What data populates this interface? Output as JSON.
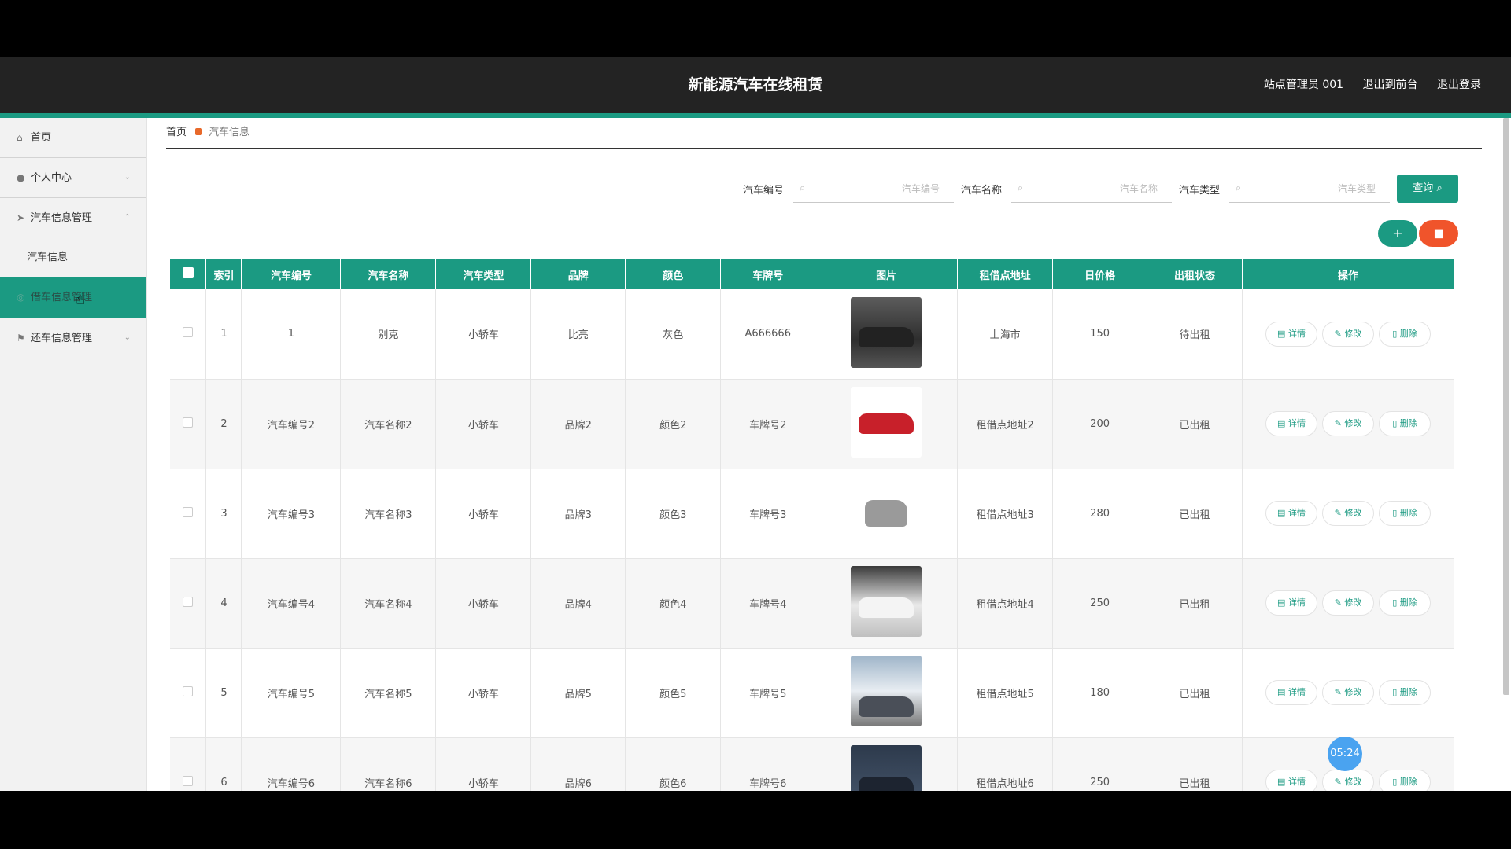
{
  "header": {
    "title": "新能源汽车在线租赁",
    "user": "站点管理员 001",
    "to_front": "退出到前台",
    "logout": "退出登录"
  },
  "sidebar": {
    "items": [
      {
        "label": "首页",
        "icon": "home-icon"
      },
      {
        "label": "个人中心",
        "icon": "user-icon"
      },
      {
        "label": "汽车信息管理",
        "icon": "send-icon"
      },
      {
        "label": "汽车信息",
        "icon": ""
      },
      {
        "label": "借车信息管理",
        "icon": "circle-icon"
      },
      {
        "label": "还车信息管理",
        "icon": "flag-icon"
      }
    ]
  },
  "breadcrumb": {
    "home": "首页",
    "current": "汽车信息"
  },
  "search": {
    "car_no_label": "汽车编号",
    "car_no_placeholder": "汽车编号",
    "car_name_label": "汽车名称",
    "car_name_placeholder": "汽车名称",
    "car_type_label": "汽车类型",
    "car_type_placeholder": "汽车类型",
    "query_label": "查询"
  },
  "table": {
    "headers": [
      "索引",
      "汽车编号",
      "汽车名称",
      "汽车类型",
      "品牌",
      "颜色",
      "车牌号",
      "图片",
      "租借点地址",
      "日价格",
      "出租状态",
      "操作"
    ],
    "rows": [
      {
        "index": "1",
        "no": "1",
        "name": "别克",
        "type": "小轿车",
        "brand": "比亮",
        "color": "灰色",
        "plate": "A666666",
        "addr": "上海市",
        "price": "150",
        "status": "待出租"
      },
      {
        "index": "2",
        "no": "汽车编号2",
        "name": "汽车名称2",
        "type": "小轿车",
        "brand": "品牌2",
        "color": "颜色2",
        "plate": "车牌号2",
        "addr": "租借点地址2",
        "price": "200",
        "status": "已出租"
      },
      {
        "index": "3",
        "no": "汽车编号3",
        "name": "汽车名称3",
        "type": "小轿车",
        "brand": "品牌3",
        "color": "颜色3",
        "plate": "车牌号3",
        "addr": "租借点地址3",
        "price": "280",
        "status": "已出租"
      },
      {
        "index": "4",
        "no": "汽车编号4",
        "name": "汽车名称4",
        "type": "小轿车",
        "brand": "品牌4",
        "color": "颜色4",
        "plate": "车牌号4",
        "addr": "租借点地址4",
        "price": "250",
        "status": "已出租"
      },
      {
        "index": "5",
        "no": "汽车编号5",
        "name": "汽车名称5",
        "type": "小轿车",
        "brand": "品牌5",
        "color": "颜色5",
        "plate": "车牌号5",
        "addr": "租借点地址5",
        "price": "180",
        "status": "已出租"
      },
      {
        "index": "6",
        "no": "汽车编号6",
        "name": "汽车名称6",
        "type": "小轿车",
        "brand": "品牌6",
        "color": "颜色6",
        "plate": "车牌号6",
        "addr": "租借点地址6",
        "price": "250",
        "status": "已出租"
      }
    ],
    "ops": {
      "detail": "详情",
      "edit": "修改",
      "delete": "删除"
    }
  },
  "timer": "05:24",
  "colors": {
    "accent": "#1b9a82",
    "danger": "#f0542b",
    "header": "#232323"
  }
}
